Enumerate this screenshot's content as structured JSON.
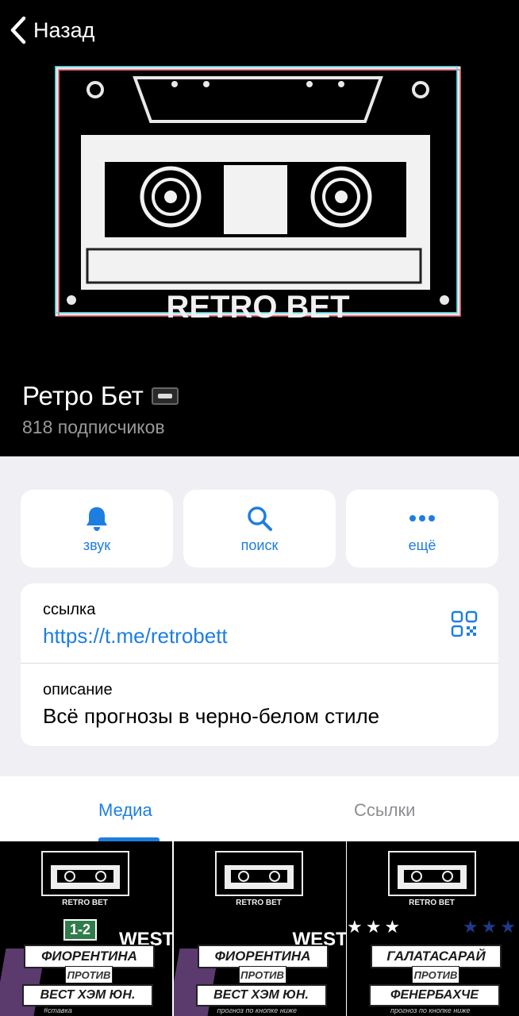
{
  "header": {
    "back_label": "Назад",
    "cover_text": "RETRO BET",
    "channel_name": "Ретро Бет",
    "subscribers": "818 подписчиков"
  },
  "actions": [
    {
      "label": "звук",
      "icon": "bell-icon"
    },
    {
      "label": "поиск",
      "icon": "search-icon"
    },
    {
      "label": "ещё",
      "icon": "more-icon"
    }
  ],
  "info": {
    "link_label": "ссылка",
    "link_url": "https://t.me/retrobett",
    "description_label": "описание",
    "description_text": "Всё прогнозы в черно-белом стиле"
  },
  "tabs": {
    "media": "Медиа",
    "links": "Ссылки",
    "active": "media"
  },
  "media": [
    {
      "logo": "RETRO BET",
      "score": "1-2",
      "side": "WEST",
      "team1": "ФИОРЕНТИНА",
      "vs": "ПРОТИВ",
      "team2": "ВЕСТ ХЭМ ЮН.",
      "caption": "#ставка"
    },
    {
      "logo": "RETRO BET",
      "side": "WEST",
      "team1": "ФИОРЕНТИНА",
      "vs": "ПРОТИВ",
      "team2": "ВЕСТ ХЭМ ЮН.",
      "caption": "прогноз по кнопке ниже"
    },
    {
      "logo": "RETRO BET",
      "team1": "ГАЛАТАСАРАЙ",
      "vs": "ПРОТИВ",
      "team2": "ФЕНЕРБАХЧЕ",
      "caption": "прогноз по кнопке ниже"
    }
  ],
  "colors": {
    "accent": "#1e7ee0",
    "background": "#efeff4",
    "header_bg": "#000000"
  }
}
